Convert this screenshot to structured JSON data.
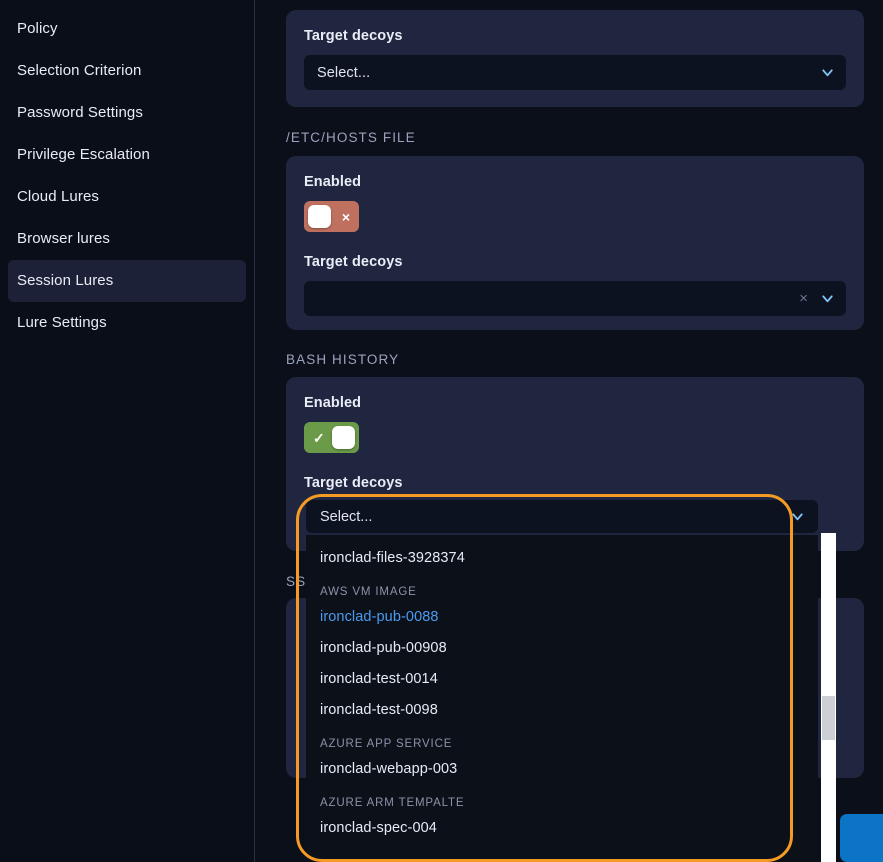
{
  "sidebar": {
    "items": [
      {
        "label": "Policy",
        "active": false
      },
      {
        "label": "Selection Criterion",
        "active": false
      },
      {
        "label": "Password Settings",
        "active": false
      },
      {
        "label": "Privilege Escalation",
        "active": false
      },
      {
        "label": "Cloud Lures",
        "active": false
      },
      {
        "label": "Browser lures",
        "active": false
      },
      {
        "label": "Session Lures",
        "active": true
      },
      {
        "label": "Lure Settings",
        "active": false
      }
    ]
  },
  "main": {
    "top_card": {
      "target_decoys_label": "Target decoys",
      "select_placeholder": "Select...",
      "chevron_icon": "chevron-down-icon"
    },
    "hosts_section": {
      "heading": "/ETC/HOSTS FILE",
      "enabled_label": "Enabled",
      "enabled_state": "off",
      "toggle_off_glyph": "×",
      "target_decoys_label": "Target decoys",
      "select_value": "",
      "clear_icon": "×",
      "chevron_icon": "chevron-down-icon"
    },
    "bash_section": {
      "heading": "BASH HISTORY",
      "enabled_label": "Enabled",
      "enabled_state": "on",
      "toggle_on_glyph": "✓",
      "target_decoys_label": "Target decoys",
      "select_placeholder": "Select..."
    },
    "partial_heading_behind_dropdown": "SS"
  },
  "dropdown": {
    "open": true,
    "control_placeholder": "Select...",
    "chevron_icon": "chevron-down-icon",
    "highlight_color": "#f59a23",
    "selected_color": "#4b9bf0",
    "options": [
      {
        "kind": "option",
        "label": "ironclad-files-3928374",
        "selected": false
      },
      {
        "kind": "group",
        "label": "AWS VM IMAGE"
      },
      {
        "kind": "option",
        "label": "ironclad-pub-0088",
        "selected": true
      },
      {
        "kind": "option",
        "label": "ironclad-pub-00908",
        "selected": false
      },
      {
        "kind": "option",
        "label": "ironclad-test-0014",
        "selected": false
      },
      {
        "kind": "option",
        "label": "ironclad-test-0098",
        "selected": false
      },
      {
        "kind": "group",
        "label": "AZURE APP SERVICE"
      },
      {
        "kind": "option",
        "label": "ironclad-webapp-003",
        "selected": false
      },
      {
        "kind": "group",
        "label": "AZURE ARM TEMPALTE"
      },
      {
        "kind": "option",
        "label": "ironclad-spec-004",
        "selected": false
      }
    ]
  }
}
